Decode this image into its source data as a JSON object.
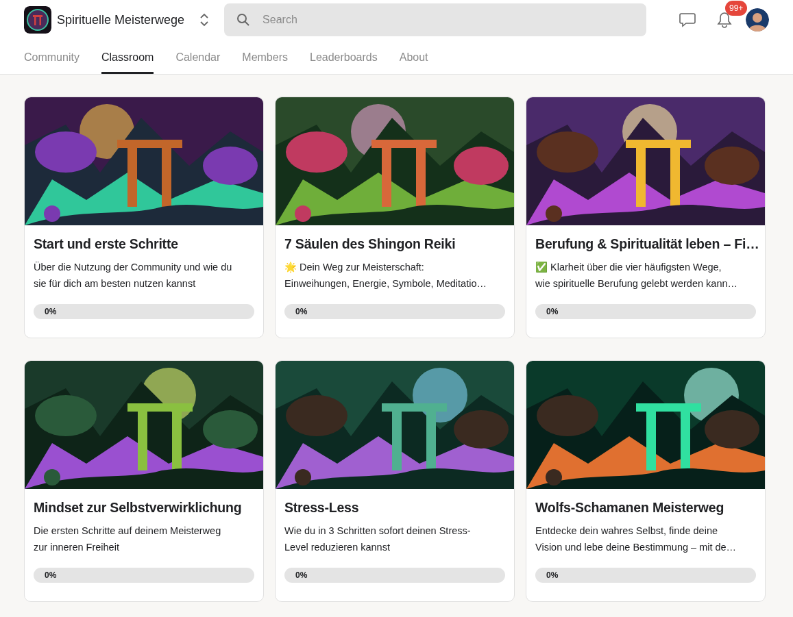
{
  "header": {
    "group_name": "Spirituelle Meisterwege",
    "search": {
      "placeholder": "Search"
    },
    "notification_badge": "99+"
  },
  "tabs": [
    {
      "label": "Community",
      "selected": false
    },
    {
      "label": "Classroom",
      "selected": true
    },
    {
      "label": "Calendar",
      "selected": false
    },
    {
      "label": "Members",
      "selected": false
    },
    {
      "label": "Leaderboards",
      "selected": false
    },
    {
      "label": "About",
      "selected": false
    }
  ],
  "courses": [
    {
      "title": "Start und erste Schritte",
      "description_lines": [
        "Über die Nutzung der Community und wie du",
        "sie für dich am besten nutzen kannst"
      ],
      "progress": "0%",
      "level": 0
    },
    {
      "title": "7 Säulen des Shingon Reiki",
      "description_lines": [
        "🌟 Dein Weg zur Meisterschaft:",
        "Einweihungen, Energie, Symbole, Meditatio…"
      ],
      "progress": "0%",
      "level": 0
    },
    {
      "title": "Berufung & Spiritualität leben – Fi…",
      "description_lines": [
        "✅ Klarheit über die vier häufigsten Wege,",
        "wie spirituelle Berufung gelebt werden kann…"
      ],
      "progress": "0%",
      "level": 0
    },
    {
      "title": "Mindset zur Selbstverwirklichung",
      "description_lines": [
        "Die ersten Schritte auf deinem Meisterweg",
        "zur inneren Freiheit"
      ],
      "progress": "0%",
      "level": 0
    },
    {
      "title": "Stress-Less",
      "description_lines": [
        "Wie du in 3 Schritten sofort deinen Stress-",
        "Level reduzieren kannst"
      ],
      "progress": "0%",
      "level": 0
    },
    {
      "title": "Wolfs-Schamanen Meisterweg",
      "description_lines": [
        "Entdecke dein wahres Selbst, finde deine",
        "Vision und lebe deine Bestimmung – mit de…"
      ],
      "progress": "0%",
      "level": 0
    }
  ]
}
